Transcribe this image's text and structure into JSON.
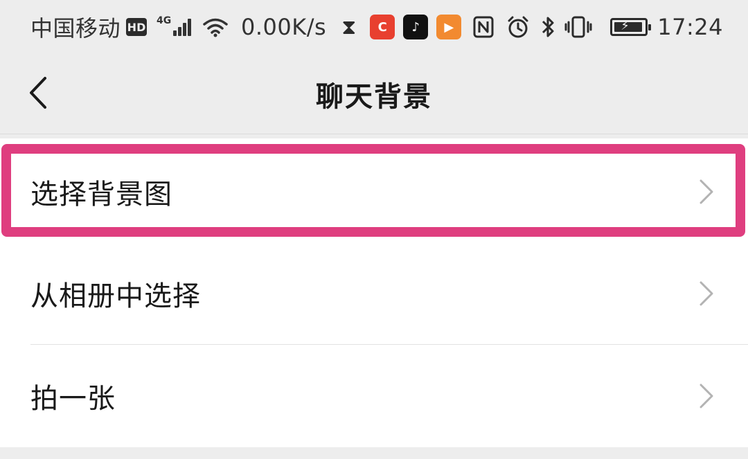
{
  "status_bar": {
    "carrier": "中国移动",
    "hd_badge": "HD",
    "network_type": "4G",
    "net_speed": "0.00K/s",
    "apps": [
      {
        "name": "app-c-618",
        "glyph": "C",
        "color": "#e8402f"
      },
      {
        "name": "tiktok",
        "glyph": "♪",
        "color": "#111111"
      },
      {
        "name": "video-player",
        "glyph": "▶",
        "color": "#f28a30"
      }
    ],
    "time": "17:24"
  },
  "nav": {
    "title": "聊天背景"
  },
  "list": {
    "items": [
      {
        "label": "选择背景图"
      },
      {
        "label": "从相册中选择"
      },
      {
        "label": "拍一张"
      }
    ]
  },
  "colors": {
    "highlight": "#df3e7f",
    "background": "#ededed",
    "chevron": "#b3b3b3"
  }
}
